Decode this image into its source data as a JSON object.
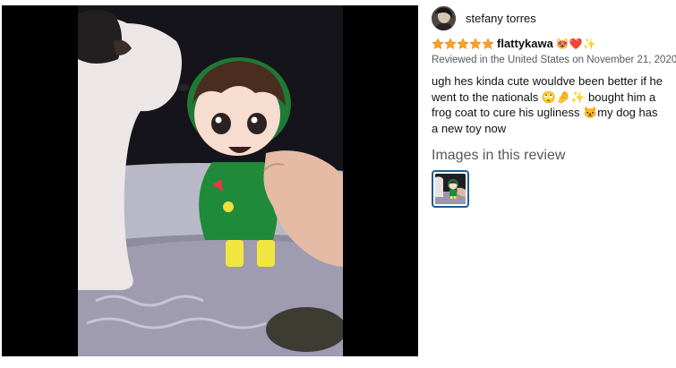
{
  "viewer": {
    "image_icon": "review-photo"
  },
  "review": {
    "author": "stefany torres",
    "rating": 5,
    "rating_max": 5,
    "title": "flattykawa",
    "title_emoji": "😻❤️✨",
    "date": "Reviewed in the United States on November 21, 2020",
    "body": "ugh hes kinda cute wouldve been better if he went to the nationals 🙄🤌✨ bought him a frog coat to cure his ugliness 😾my dog has a new toy now",
    "images_heading": "Images in this review"
  },
  "colors": {
    "star": "#ffa41c",
    "thumb_border": "#1d5f91",
    "date": "#565959"
  }
}
